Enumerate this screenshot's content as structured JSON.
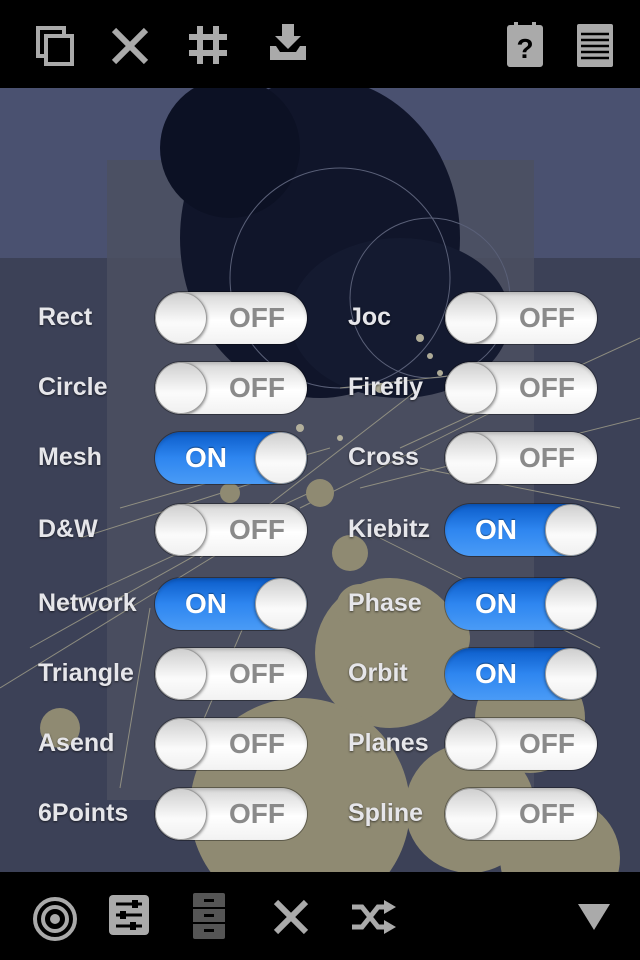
{
  "toolbar_top": {
    "left_icons": [
      "copy-icon",
      "close-icon",
      "grid-icon",
      "download-tray-icon"
    ],
    "right_icons": [
      "help-icon",
      "notepad-icon"
    ]
  },
  "toolbar_bottom": {
    "icons": [
      "target-icon",
      "sliders-icon",
      "cabinet-icon",
      "close-icon",
      "shuffle-icon",
      "triangle-down-icon"
    ]
  },
  "toggles_left": [
    {
      "label": "Rect",
      "state": "OFF"
    },
    {
      "label": "Circle",
      "state": "OFF"
    },
    {
      "label": "Mesh",
      "state": "ON"
    },
    {
      "label": "D&W",
      "state": "OFF"
    },
    {
      "label": "Network",
      "state": "ON"
    },
    {
      "label": "Triangle",
      "state": "OFF"
    },
    {
      "label": "Asend",
      "state": "OFF"
    },
    {
      "label": "6Points",
      "state": "OFF"
    }
  ],
  "toggles_right": [
    {
      "label": "Joc",
      "state": "OFF"
    },
    {
      "label": "Firefly",
      "state": "OFF"
    },
    {
      "label": "Cross",
      "state": "OFF"
    },
    {
      "label": "Kiebitz",
      "state": "ON"
    },
    {
      "label": "Phase",
      "state": "ON"
    },
    {
      "label": "Orbit",
      "state": "ON"
    },
    {
      "label": "Planes",
      "state": "OFF"
    },
    {
      "label": "Spline",
      "state": "OFF"
    }
  ],
  "colors": {
    "switch_on": "#2e86f0",
    "toolbar": "#000000",
    "art_dots": "#8f8a72"
  }
}
